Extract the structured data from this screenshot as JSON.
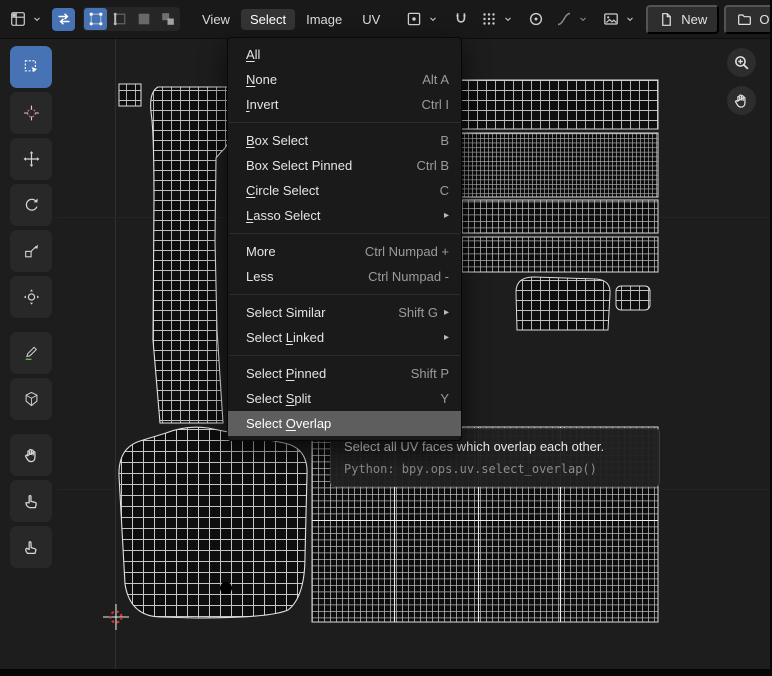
{
  "accent_color": "#4772b3",
  "header": {
    "editor_type": {
      "icon": "editor-type"
    },
    "uv_sync": {
      "icon": "sync",
      "active": true
    },
    "select_modes": [
      {
        "name": "vertex",
        "icon": "mode-vertex",
        "active": true
      },
      {
        "name": "edge",
        "icon": "mode-edge",
        "active": false
      },
      {
        "name": "face",
        "icon": "mode-face",
        "active": false
      },
      {
        "name": "island",
        "icon": "mode-island",
        "active": false
      }
    ],
    "menus": [
      {
        "label": "View",
        "active": false
      },
      {
        "label": "Select",
        "active": true
      },
      {
        "label": "Image",
        "active": false
      },
      {
        "label": "UV",
        "active": false
      }
    ],
    "new_button": {
      "label": "New"
    },
    "open_button": {
      "label": "Open"
    }
  },
  "toolbar": {
    "tools": [
      {
        "name": "select-box",
        "icon": "t-box",
        "active": true
      },
      {
        "name": "cursor",
        "icon": "t-cursor",
        "active": false
      },
      {
        "name": "move",
        "icon": "t-move",
        "active": false
      },
      {
        "name": "rotate",
        "icon": "t-rotate",
        "active": false
      },
      {
        "name": "scale",
        "icon": "t-scale",
        "active": false
      },
      {
        "name": "transform",
        "icon": "t-transform",
        "active": false
      },
      {
        "name": "annotate",
        "icon": "t-pen",
        "active": false,
        "gap_before": true
      },
      {
        "name": "measure",
        "icon": "t-cube",
        "active": false
      },
      {
        "name": "grab",
        "icon": "hand",
        "active": false,
        "gap_before": true
      },
      {
        "name": "relax",
        "icon": "finger",
        "active": false
      },
      {
        "name": "pinch",
        "icon": "pinch",
        "active": false
      }
    ]
  },
  "select_menu": {
    "items": [
      {
        "label": "All",
        "shortcut": "",
        "underline": 0,
        "submenu": false,
        "highlighted": false,
        "separator_after": false
      },
      {
        "label": "None",
        "shortcut": "Alt A",
        "underline": 0,
        "submenu": false,
        "highlighted": false,
        "separator_after": false
      },
      {
        "label": "Invert",
        "shortcut": "Ctrl I",
        "underline": 0,
        "submenu": false,
        "highlighted": false,
        "separator_after": true
      },
      {
        "label": "Box Select",
        "shortcut": "B",
        "underline": 0,
        "submenu": false,
        "highlighted": false,
        "separator_after": false
      },
      {
        "label": "Box Select Pinned",
        "shortcut": "Ctrl B",
        "underline": -1,
        "submenu": false,
        "highlighted": false,
        "separator_after": false
      },
      {
        "label": "Circle Select",
        "shortcut": "C",
        "underline": 0,
        "submenu": false,
        "highlighted": false,
        "separator_after": false
      },
      {
        "label": "Lasso Select",
        "shortcut": "",
        "underline": 0,
        "submenu": true,
        "highlighted": false,
        "separator_after": true
      },
      {
        "label": "More",
        "shortcut": "Ctrl Numpad +",
        "underline": -1,
        "submenu": false,
        "highlighted": false,
        "separator_after": false
      },
      {
        "label": "Less",
        "shortcut": "Ctrl Numpad -",
        "underline": -1,
        "submenu": false,
        "highlighted": false,
        "separator_after": true
      },
      {
        "label": "Select Similar",
        "shortcut": "Shift G",
        "underline": -1,
        "submenu": true,
        "highlighted": false,
        "separator_after": false
      },
      {
        "label": "Select Linked",
        "shortcut": "",
        "underline": 7,
        "submenu": true,
        "highlighted": false,
        "separator_after": true
      },
      {
        "label": "Select Pinned",
        "shortcut": "Shift P",
        "underline": 7,
        "submenu": false,
        "highlighted": false,
        "separator_after": false
      },
      {
        "label": "Select Split",
        "shortcut": "Y",
        "underline": 7,
        "submenu": false,
        "highlighted": false,
        "separator_after": false
      },
      {
        "label": "Select Overlap",
        "shortcut": "",
        "underline": 7,
        "submenu": false,
        "highlighted": true,
        "separator_after": false
      }
    ]
  },
  "tooltip": {
    "title": "Select all UV faces which overlap each other.",
    "python_line": "Python: bpy.ops.uv.select_overlap()"
  },
  "nav": [
    {
      "name": "zoom",
      "icon": "zoom"
    },
    {
      "name": "pan",
      "icon": "hand"
    }
  ]
}
